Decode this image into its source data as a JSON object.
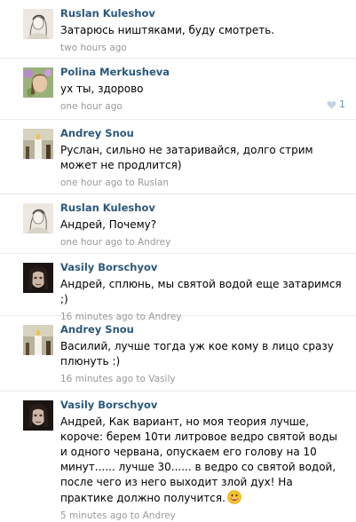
{
  "comments": [
    {
      "author": "Ruslan Kuleshov",
      "text": "Затарюсь ништяками, буду смотреть.",
      "time": "two hours ago",
      "reply_sep": "",
      "reply_to": "",
      "avatar": "sketch-portrait-avatar"
    },
    {
      "author": "Polina Merkusheva",
      "text": "ух ты, здорово",
      "time": "one hour ago",
      "reply_sep": "",
      "reply_to": "",
      "avatar": "girl-flowers-avatar",
      "likes": "1"
    },
    {
      "author": "Andrey Snou",
      "text": "Руслан, сильно не затаривайся, долго стрим может не продлится)",
      "time": "one hour ago",
      "reply_sep": " to ",
      "reply_to": "Ruslan",
      "avatar": "candle-avatar"
    },
    {
      "author": "Ruslan Kuleshov",
      "text": "Андрей, Почему?",
      "time": "one hour ago",
      "reply_sep": " to ",
      "reply_to": "Andrey",
      "avatar": "sketch-portrait-avatar"
    },
    {
      "author": "Vasily Borschyov",
      "text": "Андрей, сплюнь, мы святой водой еще затаримся ;)",
      "time": "16 minutes ago",
      "reply_sep": " to ",
      "reply_to": "Andrey",
      "avatar": "dark-face-avatar"
    },
    {
      "author": "Andrey Snou",
      "text": "Василий, лучше тогда уж кое кому в лицо сразу плюнуть :)",
      "time": "16 minutes ago",
      "reply_sep": " to ",
      "reply_to": "Vasily",
      "avatar": "candle-avatar"
    },
    {
      "author": "Vasily Borschyov",
      "text": "Андрей, Как вариант, но моя теория лучше, короче: берем 10ти литровое ведро святой воды и одного червана, опускаем его голову на 10 минут...... лучше 30...... в ведро со святой водой, после чего из него выходит злой дух! На практике должно получится.",
      "time": "5 minutes ago",
      "reply_sep": " to ",
      "reply_to": "Andrey",
      "avatar": "dark-face-avatar",
      "emoji": "grinning-smiley-icon"
    }
  ],
  "colors": {
    "author": "#2b587a",
    "meta": "#999999",
    "divider": "#e7ebf0",
    "like": "#6d8fb3"
  }
}
